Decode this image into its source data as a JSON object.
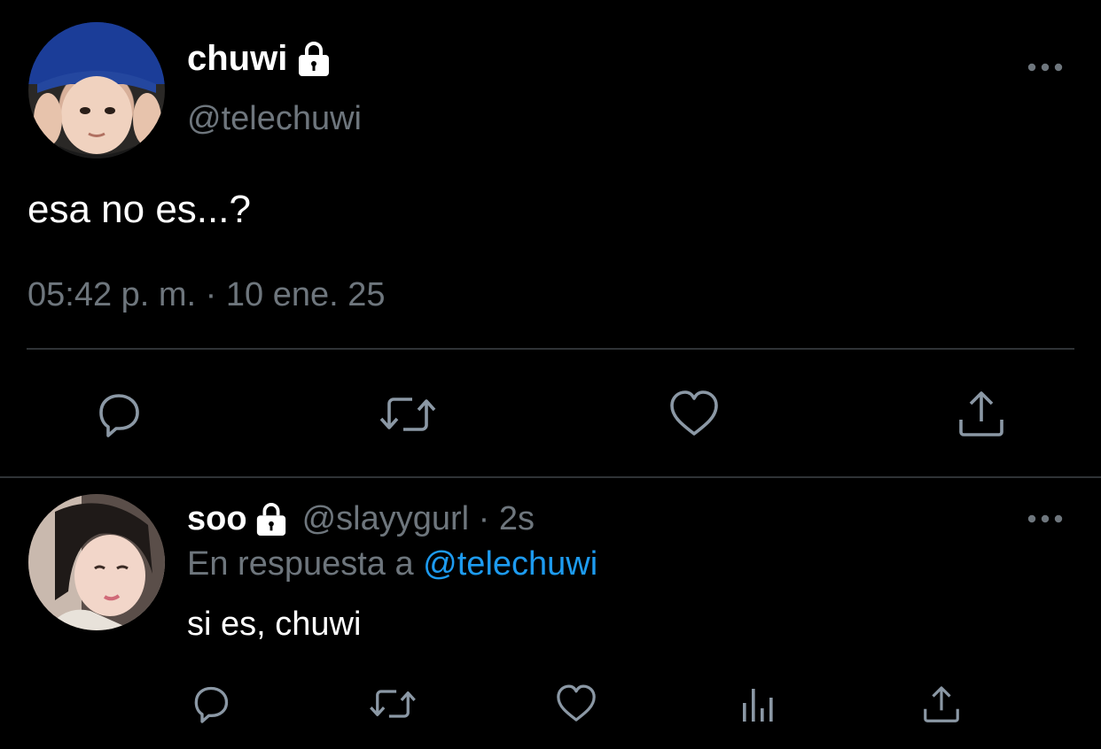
{
  "main_tweet": {
    "display_name": "chuwi",
    "handle": "@telechuwi",
    "text": "esa no es...?",
    "timestamp": "05:42 p. m. · 10 ene. 25",
    "protected_icon": "lock-icon",
    "more_icon": "more-horizontal-icon",
    "actions": [
      "reply-icon",
      "retweet-icon",
      "like-icon",
      "share-icon"
    ]
  },
  "reply_tweet": {
    "display_name": "soo",
    "handle_time": "@slayygurl · 2s",
    "reply_prefix": "En respuesta a",
    "reply_mention": "@telechuwi",
    "text": "si es, chuwi",
    "protected_icon": "lock-icon",
    "more_icon": "more-horizontal-icon",
    "actions": [
      "reply-icon",
      "retweet-icon",
      "like-icon",
      "analytics-icon",
      "share-icon"
    ]
  },
  "colors": {
    "background": "#000000",
    "primary_text": "#ffffff",
    "secondary_text": "#6e767d",
    "link": "#1d9bf0",
    "divider": "#2f3336"
  }
}
